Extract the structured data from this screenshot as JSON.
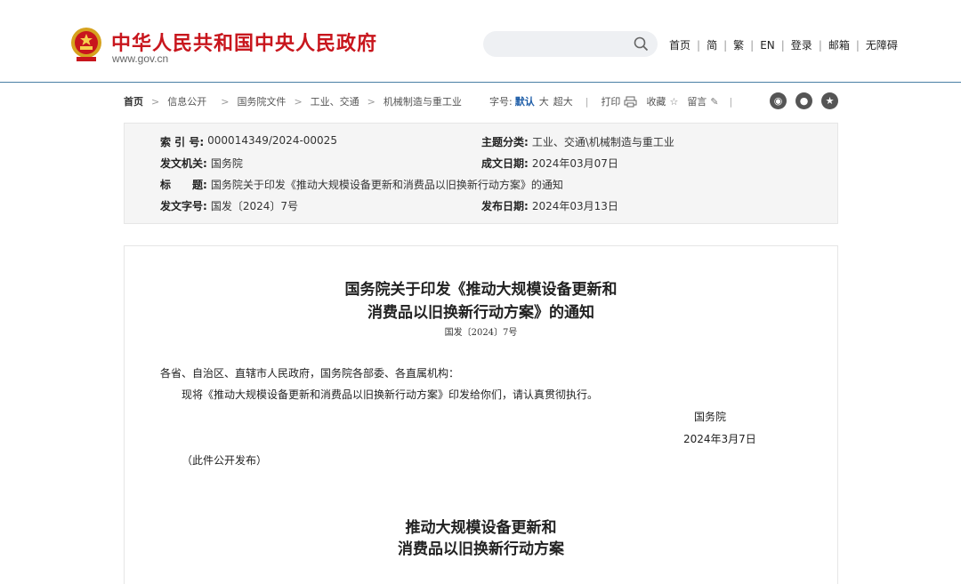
{
  "header": {
    "site_title": "中华人民共和国中央人民政府",
    "site_url": "www.gov.cn",
    "search_placeholder": "",
    "nav": [
      "首页",
      "简",
      "繁",
      "EN",
      "登录",
      "邮箱",
      "无障碍"
    ],
    "brand_color": "#c8161d"
  },
  "breadcrumb": [
    "首页",
    "信息公开",
    "国务院文件",
    "工业、交通",
    "机械制造与重工业"
  ],
  "tools": {
    "font_label": "字号:",
    "font_sizes": [
      "默认",
      "大",
      "超大"
    ],
    "print": "打印",
    "favorite": "收藏",
    "comment": "留言"
  },
  "social": [
    "weibo-icon",
    "wechat-icon",
    "star-icon"
  ],
  "meta": {
    "index_key": "索 引 号:",
    "index_val": "000014349/2024-00025",
    "category_key": "主题分类:",
    "category_val": "工业、交通\\机械制造与重工业",
    "issuer_key": "发文机关:",
    "issuer_val": "国务院",
    "created_key": "成文日期:",
    "created_val": "2024年03月07日",
    "title_key": "标　　题:",
    "title_val": "国务院关于印发《推动大规模设备更新和消费品以旧换新行动方案》的通知",
    "docno_key": "发文字号:",
    "docno_val": "国发〔2024〕7号",
    "published_key": "发布日期:",
    "published_val": "2024年03月13日"
  },
  "article": {
    "title_line1": "国务院关于印发《推动大规模设备更新和",
    "title_line2": "消费品以旧换新行动方案》的通知",
    "doc_no": "国发〔2024〕7号",
    "salutation": "各省、自治区、直辖市人民政府，国务院各部委、各直属机构：",
    "body": "现将《推动大规模设备更新和消费品以旧换新行动方案》印发给你们，请认真贯彻执行。",
    "signer": "国务院",
    "date": "2024年3月7日",
    "note": "（此件公开发布）",
    "sub_title_line1": "推动大规模设备更新和",
    "sub_title_line2": "消费品以旧换新行动方案"
  }
}
